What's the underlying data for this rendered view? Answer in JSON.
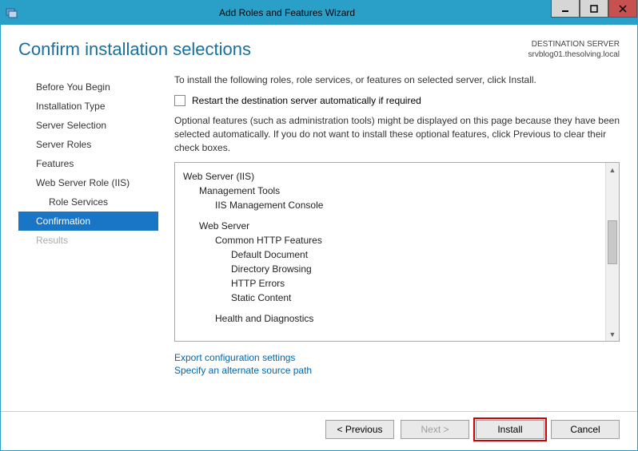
{
  "window": {
    "title": "Add Roles and Features Wizard"
  },
  "header": {
    "pageTitle": "Confirm installation selections",
    "destLabel": "DESTINATION SERVER",
    "destServer": "srvblog01.thesolving.local"
  },
  "nav": {
    "items": [
      {
        "label": "Before You Begin",
        "active": false,
        "sub": false,
        "disabled": false
      },
      {
        "label": "Installation Type",
        "active": false,
        "sub": false,
        "disabled": false
      },
      {
        "label": "Server Selection",
        "active": false,
        "sub": false,
        "disabled": false
      },
      {
        "label": "Server Roles",
        "active": false,
        "sub": false,
        "disabled": false
      },
      {
        "label": "Features",
        "active": false,
        "sub": false,
        "disabled": false
      },
      {
        "label": "Web Server Role (IIS)",
        "active": false,
        "sub": false,
        "disabled": false
      },
      {
        "label": "Role Services",
        "active": false,
        "sub": true,
        "disabled": false
      },
      {
        "label": "Confirmation",
        "active": true,
        "sub": false,
        "disabled": false
      },
      {
        "label": "Results",
        "active": false,
        "sub": false,
        "disabled": true
      }
    ]
  },
  "main": {
    "instruction": "To install the following roles, role services, or features on selected server, click Install.",
    "restartLabel": "Restart the destination server automatically if required",
    "restartChecked": false,
    "description": "Optional features (such as administration tools) might be displayed on this page because they have been selected automatically. If you do not want to install these optional features, click Previous to clear their check boxes.",
    "tree": [
      {
        "text": "Web Server (IIS)",
        "indent": 0
      },
      {
        "text": "Management Tools",
        "indent": 1
      },
      {
        "text": "IIS Management Console",
        "indent": 2
      },
      {
        "text": "Web Server",
        "indent": 1,
        "spaceBefore": true
      },
      {
        "text": "Common HTTP Features",
        "indent": 2
      },
      {
        "text": "Default Document",
        "indent": 3
      },
      {
        "text": "Directory Browsing",
        "indent": 3
      },
      {
        "text": "HTTP Errors",
        "indent": 3
      },
      {
        "text": "Static Content",
        "indent": 3
      },
      {
        "text": "Health and Diagnostics",
        "indent": 2,
        "spaceBefore": true
      }
    ],
    "links": {
      "export": "Export configuration settings",
      "altSource": "Specify an alternate source path"
    }
  },
  "footer": {
    "previous": "< Previous",
    "next": "Next >",
    "install": "Install",
    "cancel": "Cancel"
  }
}
